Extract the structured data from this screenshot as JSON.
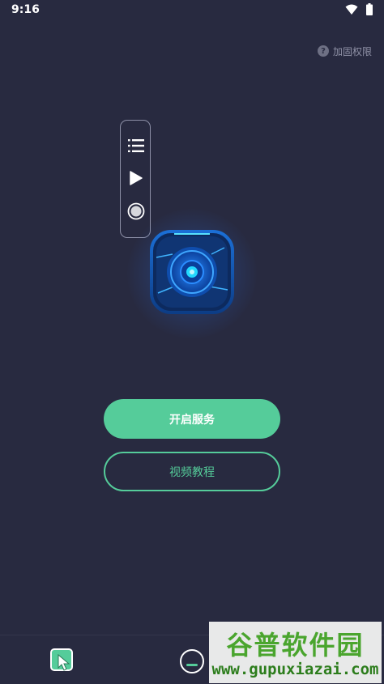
{
  "status_bar": {
    "time": "9:16",
    "icons": [
      "wifi-icon",
      "battery-icon"
    ]
  },
  "help": {
    "label": "加固权限",
    "icon": "help-icon"
  },
  "floating_panel": {
    "icons": [
      "list-icon",
      "play-icon",
      "record-icon"
    ]
  },
  "logo": {
    "icon": "eye-lens-icon",
    "colors": {
      "ring": "#1aa0ff",
      "core": "#22d8ff"
    }
  },
  "buttons": {
    "start_service": "开启服务",
    "video_tutorial": "视频教程"
  },
  "bottom_nav": {
    "tabs": [
      {
        "icon": "cursor-tap-icon",
        "active": true
      },
      {
        "icon": "minus-circle-icon",
        "active": false
      }
    ]
  },
  "watermark": {
    "title": "谷普软件园",
    "url": "www.gupuxiazai.com"
  },
  "colors": {
    "background": "#282a40",
    "accent": "#55cc9a"
  }
}
